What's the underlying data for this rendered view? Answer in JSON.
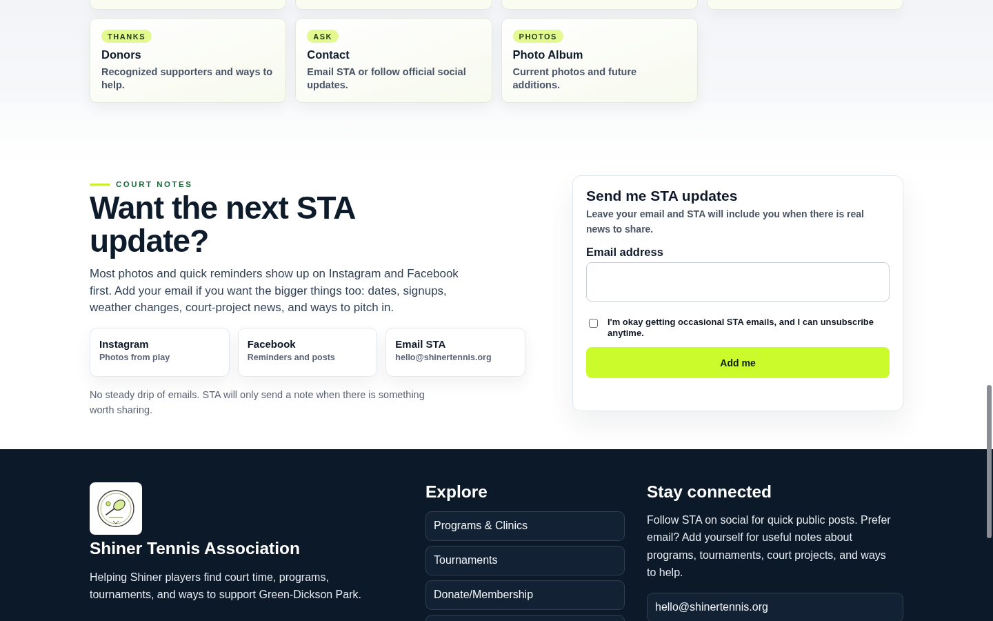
{
  "cards": [
    {
      "tag": "THANKS",
      "title": "Donors",
      "description": "Recognized supporters and ways to help."
    },
    {
      "tag": "ASK",
      "title": "Contact",
      "description": "Email STA or follow official social updates."
    },
    {
      "tag": "PHOTOS",
      "title": "Photo Album",
      "description": "Current photos and future additions."
    }
  ],
  "court_notes": {
    "eyebrow": "COURT NOTES",
    "heading": "Want the next STA update?",
    "intro": "Most photos and quick reminders show up on Instagram and Facebook first. Add your email if you want the bigger things too: dates, signups, weather changes, court-project news, and ways to pitch in.",
    "channels": [
      {
        "name": "Instagram",
        "detail": "Photos from play"
      },
      {
        "name": "Facebook",
        "detail": "Reminders and posts"
      },
      {
        "name": "Email STA",
        "detail": "hello@shinertennis.org"
      }
    ],
    "note": "No steady drip of emails. STA will only send a note when there is something worth sharing."
  },
  "signup_form": {
    "title": "Send me STA updates",
    "description": "Leave your email and STA will include you when there is real news to share.",
    "email_label": "Email address",
    "consent": {
      "label": "I'm okay getting occasional STA emails, and I can unsubscribe anytime.",
      "checked": false
    },
    "submit": "Add me"
  },
  "footer": {
    "brand": {
      "name": "Shiner Tennis Association",
      "tagline": "Helping Shiner players find court time, programs, tournaments, and ways to support Green-Dickson Park."
    },
    "explore": {
      "heading": "Explore",
      "links": [
        "Programs & Clinics",
        "Tournaments",
        "Donate/Membership"
      ]
    },
    "connect": {
      "heading": "Stay connected",
      "text": "Follow STA on social for quick public posts. Prefer email? Add yourself for useful notes about programs, tournaments, court projects, and ways to help.",
      "email": "hello@shinertennis.org"
    }
  }
}
